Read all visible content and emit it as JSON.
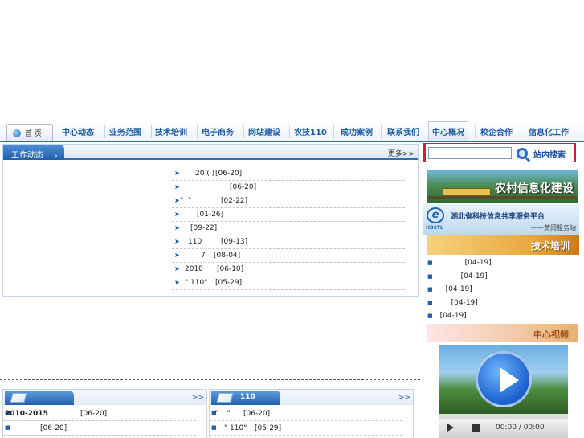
{
  "nav": {
    "home": "首 页",
    "items": [
      "中心动态",
      "业务范围",
      "技术培训",
      "电子商务",
      "网站建设",
      "农技110",
      "成功案例",
      "联系我们",
      "中心概况",
      "校企合作",
      "信息化工作"
    ]
  },
  "work": {
    "title": "工作动态",
    "more": "更多>>",
    "rows": [
      {
        "title": "20 ( )",
        "date": "[06-20]"
      },
      {
        "title": "",
        "date": "[06-20]"
      },
      {
        "title": "\"  \"",
        "date": "[02-22]"
      },
      {
        "title": "",
        "date": "[01-26]"
      },
      {
        "title": "",
        "date": "[09-22]"
      },
      {
        "title": "110",
        "date": "[09-13]"
      },
      {
        "title": "7",
        "date": "[08-04]"
      },
      {
        "title": "2010",
        "date": "[06-10]"
      },
      {
        "title": "\" 110\"",
        "date": "[05-29]"
      }
    ]
  },
  "panel_left": {
    "more": ">>",
    "rows": [
      {
        "title": "2010-2015",
        "date": "[06-20]"
      },
      {
        "title": "",
        "date": "[06-20]"
      }
    ]
  },
  "panel_right": {
    "tab": "110",
    "more": ">>",
    "rows": [
      {
        "title": "\"    \"",
        "date": "[06-20]"
      },
      {
        "title": "\" 110\"",
        "date": "[05-29]"
      }
    ]
  },
  "sidebar": {
    "search_button": "站内搜索",
    "search_value": "",
    "rural_banner": "农村信息化建设",
    "hbstl_logo": "HBSTL",
    "hbstl_title": "湖北省科技信息共享服务平台",
    "hbstl_sub": "——黄冈服务站",
    "training_title": "技术培训",
    "training_rows": [
      "[04-19]",
      "[04-19]",
      "[04-19]",
      "[04-19]",
      "[04-19]"
    ],
    "video_title": "中心视频",
    "video_time": "00:00 / 00:00"
  }
}
